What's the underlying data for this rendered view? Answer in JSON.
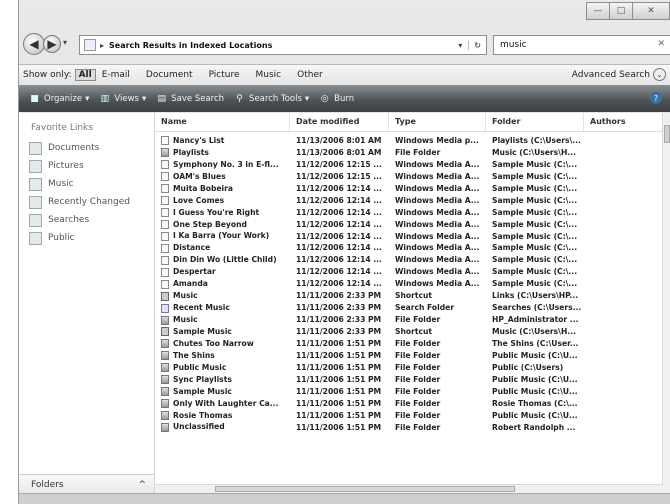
{
  "window": {
    "min_label": "—",
    "max_label": "□",
    "close_label": "✕"
  },
  "address": {
    "back_icon": "◀",
    "forward_icon": "▶",
    "recent_icon": "▾",
    "crumb_sep": "▸",
    "path": "Search Results in Indexed Locations",
    "dropdown_icon": "▾",
    "refresh_icon": "↻"
  },
  "search": {
    "value": "music",
    "clear_icon": "✕"
  },
  "filter_bar": {
    "label": "Show only:",
    "buttons": [
      "All",
      "E-mail",
      "Document",
      "Picture",
      "Music",
      "Other"
    ],
    "advanced": "Advanced Search",
    "advanced_icon": "⌄"
  },
  "toolbar": {
    "organize": "Organize",
    "views": "Views",
    "save_search": "Save Search",
    "search_tools": "Search Tools",
    "burn": "Burn",
    "help": "?"
  },
  "nav": {
    "header": "Favorite Links",
    "items": [
      "Documents",
      "Pictures",
      "Music",
      "Recently Changed",
      "Searches",
      "Public"
    ],
    "footer": "Folders",
    "footer_icon": "^"
  },
  "columns": [
    "Name",
    "Date modified",
    "Type",
    "Folder",
    "Authors"
  ],
  "rows": [
    {
      "name": "Nancy's List",
      "date": "11/13/2006 8:01 AM",
      "type": "Windows Media p...",
      "folder": "Playlists (C:\\Users\\...",
      "icon": "media"
    },
    {
      "name": "Playlists",
      "date": "11/13/2006 8:01 AM",
      "type": "File Folder",
      "folder": "Music (C:\\Users\\H...",
      "icon": "folder"
    },
    {
      "name": "Symphony No. 3 in E-fl...",
      "date": "11/12/2006 12:15 ...",
      "type": "Windows Media A...",
      "folder": "Sample Music (C:\\...",
      "icon": "song"
    },
    {
      "name": "OAM's Blues",
      "date": "11/12/2006 12:15 ...",
      "type": "Windows Media A...",
      "folder": "Sample Music (C:\\...",
      "icon": "song"
    },
    {
      "name": "Muita Bobeira",
      "date": "11/12/2006 12:14 ...",
      "type": "Windows Media A...",
      "folder": "Sample Music (C:\\...",
      "icon": "song"
    },
    {
      "name": "Love Comes",
      "date": "11/12/2006 12:14 ...",
      "type": "Windows Media A...",
      "folder": "Sample Music (C:\\...",
      "icon": "song"
    },
    {
      "name": "I Guess You're Right",
      "date": "11/12/2006 12:14 ...",
      "type": "Windows Media A...",
      "folder": "Sample Music (C:\\...",
      "icon": "song"
    },
    {
      "name": "One Step Beyond",
      "date": "11/12/2006 12:14 ...",
      "type": "Windows Media A...",
      "folder": "Sample Music (C:\\...",
      "icon": "song"
    },
    {
      "name": "I Ka Barra (Your Work)",
      "date": "11/12/2006 12:14 ...",
      "type": "Windows Media A...",
      "folder": "Sample Music (C:\\...",
      "icon": "song"
    },
    {
      "name": "Distance",
      "date": "11/12/2006 12:14 ...",
      "type": "Windows Media A...",
      "folder": "Sample Music (C:\\...",
      "icon": "song"
    },
    {
      "name": "Din Din Wo (Little Child)",
      "date": "11/12/2006 12:14 ...",
      "type": "Windows Media A...",
      "folder": "Sample Music (C:\\...",
      "icon": "song"
    },
    {
      "name": "Despertar",
      "date": "11/12/2006 12:14 ...",
      "type": "Windows Media A...",
      "folder": "Sample Music (C:\\...",
      "icon": "song"
    },
    {
      "name": "Amanda",
      "date": "11/12/2006 12:14 ...",
      "type": "Windows Media A...",
      "folder": "Sample Music (C:\\...",
      "icon": "song"
    },
    {
      "name": "Music",
      "date": "11/11/2006 2:33 PM",
      "type": "Shortcut",
      "folder": "Links (C:\\Users\\HP...",
      "icon": "shortcut"
    },
    {
      "name": "Recent Music",
      "date": "11/11/2006 2:33 PM",
      "type": "Search Folder",
      "folder": "Searches (C:\\Users...",
      "icon": "searchf"
    },
    {
      "name": "Music",
      "date": "11/11/2006 2:33 PM",
      "type": "File Folder",
      "folder": "HP_Administrator ...",
      "icon": "folder"
    },
    {
      "name": "Sample Music",
      "date": "11/11/2006 2:33 PM",
      "type": "Shortcut",
      "folder": "Music (C:\\Users\\H...",
      "icon": "shortcut"
    },
    {
      "name": "Chutes Too Narrow",
      "date": "11/11/2006 1:51 PM",
      "type": "File Folder",
      "folder": "The Shins (C:\\User...",
      "icon": "folder"
    },
    {
      "name": "The Shins",
      "date": "11/11/2006 1:51 PM",
      "type": "File Folder",
      "folder": "Public Music (C:\\U...",
      "icon": "folder"
    },
    {
      "name": "Public Music",
      "date": "11/11/2006 1:51 PM",
      "type": "File Folder",
      "folder": "Public (C:\\Users)",
      "icon": "folder"
    },
    {
      "name": "Sync Playlists",
      "date": "11/11/2006 1:51 PM",
      "type": "File Folder",
      "folder": "Public Music (C:\\U...",
      "icon": "folder"
    },
    {
      "name": "Sample Music",
      "date": "11/11/2006 1:51 PM",
      "type": "File Folder",
      "folder": "Public Music (C:\\U...",
      "icon": "folder"
    },
    {
      "name": "Only With Laughter Ca...",
      "date": "11/11/2006 1:51 PM",
      "type": "File Folder",
      "folder": "Rosie Thomas (C:\\...",
      "icon": "folder"
    },
    {
      "name": "Rosie Thomas",
      "date": "11/11/2006 1:51 PM",
      "type": "File Folder",
      "folder": "Public Music (C:\\U...",
      "icon": "folder"
    },
    {
      "name": "Unclassified",
      "date": "11/11/2006 1:51 PM",
      "type": "File Folder",
      "folder": "Robert Randolph ...",
      "icon": "folder"
    }
  ]
}
